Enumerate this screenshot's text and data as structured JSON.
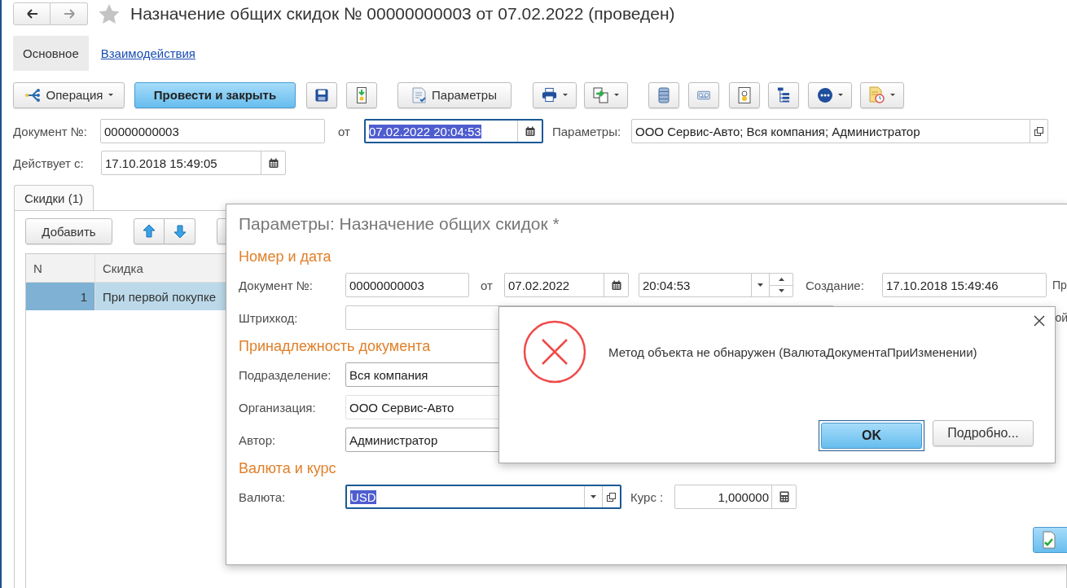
{
  "window": {
    "title": "Назначение общих скидок № 00000000003 от 07.02.2022 (проведен)",
    "favorite": false
  },
  "nav_tabs": [
    {
      "label": "Основное",
      "selected": true
    },
    {
      "label": "Взаимодействия",
      "selected": false
    }
  ],
  "toolbar": {
    "operation": "Операция",
    "post_and_close": "Провести и закрыть",
    "parameters": "Параметры"
  },
  "header_fields": {
    "number": {
      "label": "Документ №:",
      "value": "00000000003"
    },
    "date": {
      "label": "от",
      "value": "07.02.2022 20:04:53",
      "text_selected": true,
      "focused": true
    },
    "parameters": {
      "label": "Параметры:",
      "value": "ООО Сервис-Авто; Вся компания; Администратор"
    },
    "valid_from": {
      "label": "Действует с:",
      "value": "17.10.2018 15:49:05"
    }
  },
  "discounts": {
    "tab": {
      "label": "Скидки (1)",
      "selected": true
    },
    "add_button": "Добавить",
    "columns": [
      "N",
      "Скидка"
    ],
    "rows": [
      {
        "n": "1",
        "discount": "При первой покупке",
        "selected": true
      }
    ]
  },
  "parameters_window": {
    "title": "Параметры: Назначение общих скидок *",
    "number_section": "Номер и дата",
    "number": {
      "label": "Документ №:",
      "value": "00000000003"
    },
    "date": {
      "label": "от",
      "value": "07.02.2022"
    },
    "time": {
      "value": "20:04:53"
    },
    "created": {
      "label": "Создание:",
      "value": "17.10.2018 15:49:46"
    },
    "column_cut_text_1": "Пр",
    "barcode": {
      "label": "Штрихкод:"
    },
    "column_cut_text_2": "ой",
    "ownership_section": "Принадлежность документа",
    "department": {
      "label": "Подразделение:",
      "value": "Вся компания"
    },
    "organization": {
      "label": "Организация:",
      "value": "ООО Сервис-Авто"
    },
    "author": {
      "label": "Автор:",
      "value": "Администратор"
    },
    "currency_section": "Валюта и курс",
    "currency": {
      "label": "Валюта:",
      "value": "USD",
      "text_selected": true,
      "focused": true
    },
    "rate": {
      "label": "Курс :",
      "value": "1,000000"
    }
  },
  "error_dialog": {
    "message": "Метод объекта не обнаружен (ВалютаДокументаПриИзменении)",
    "ok_button": "OK",
    "details_button": "Подробно..."
  }
}
